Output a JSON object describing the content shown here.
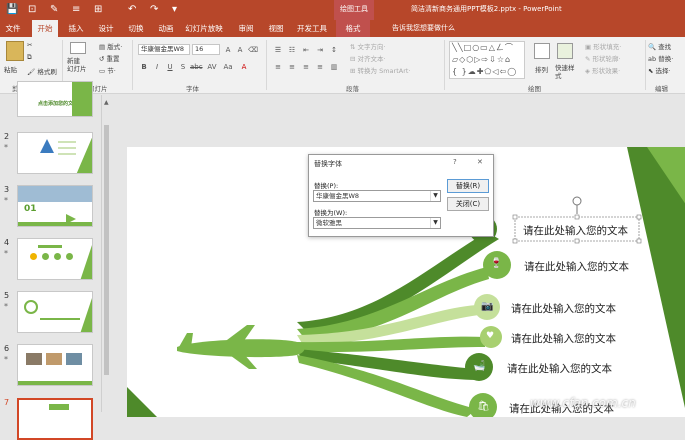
{
  "qat": {
    "save": "💾",
    "undo": "↶",
    "redo": "↷",
    "more": "▾"
  },
  "context_group": "绘图工具",
  "doc_title": "简洁清新商务通用PPT模板2.pptx  -  PowerPoint",
  "tabs": [
    {
      "label": "文件"
    },
    {
      "label": "开始"
    },
    {
      "label": "插入"
    },
    {
      "label": "设计"
    },
    {
      "label": "切换"
    },
    {
      "label": "动画"
    },
    {
      "label": "幻灯片放映"
    },
    {
      "label": "审阅"
    },
    {
      "label": "视图"
    },
    {
      "label": "开发工具"
    },
    {
      "label": "格式"
    }
  ],
  "tell_me": "告诉我您想要做什么",
  "ribbon": {
    "paste": "粘贴",
    "clip_items": [
      "剪切",
      "复制",
      "格式刷"
    ],
    "new_slide": "新建\n幻灯片",
    "slide_items": [
      "版式·",
      "重置",
      "节·"
    ],
    "font_name": "华康俪金黑W8",
    "font_size": "16",
    "para_items": [
      "文字方向·",
      "对齐文本·",
      "转换为 SmartArt·"
    ],
    "arrange": "排列",
    "quick_styles": "快速样式",
    "shape_items": [
      "形状填充·",
      "形状轮廓·",
      "形状效果·"
    ],
    "edit_items": [
      "查找",
      "替换·",
      "选择·"
    ],
    "groups": [
      "剪贴板",
      "幻灯片",
      "字体",
      "段落",
      "绘图",
      "编辑"
    ]
  },
  "thumbs": [
    {
      "num": "",
      "title": "点击添加您的文本"
    },
    {
      "num": "2",
      "star": "*"
    },
    {
      "num": "3",
      "star": "*",
      "text": "01"
    },
    {
      "num": "4",
      "star": "*"
    },
    {
      "num": "5",
      "star": "*"
    },
    {
      "num": "6",
      "star": "*"
    },
    {
      "num": "7",
      "star": ""
    }
  ],
  "dialog": {
    "title": "替换字体",
    "help": "?",
    "close": "✕",
    "replace_label": "替换(P):",
    "replace_value": "华康俪金黑W8",
    "with_label": "替换为(W):",
    "with_value": "微软雅黑",
    "btn_replace": "替换(R)",
    "btn_close": "关闭(C)"
  },
  "slide": {
    "bullets": [
      "请在此处输入您的文本",
      "请在此处输入您的文本",
      "请在此处输入您的文本",
      "请在此处输入您的文本",
      "请在此处输入您的文本",
      "请在此处输入您的文本"
    ]
  },
  "watermark": "www.cfan.com.cn",
  "colors": {
    "accent": "#b7472a",
    "green": "#7ab648",
    "dark_green": "#4e8a2a",
    "light_green": "#c5e09b"
  }
}
